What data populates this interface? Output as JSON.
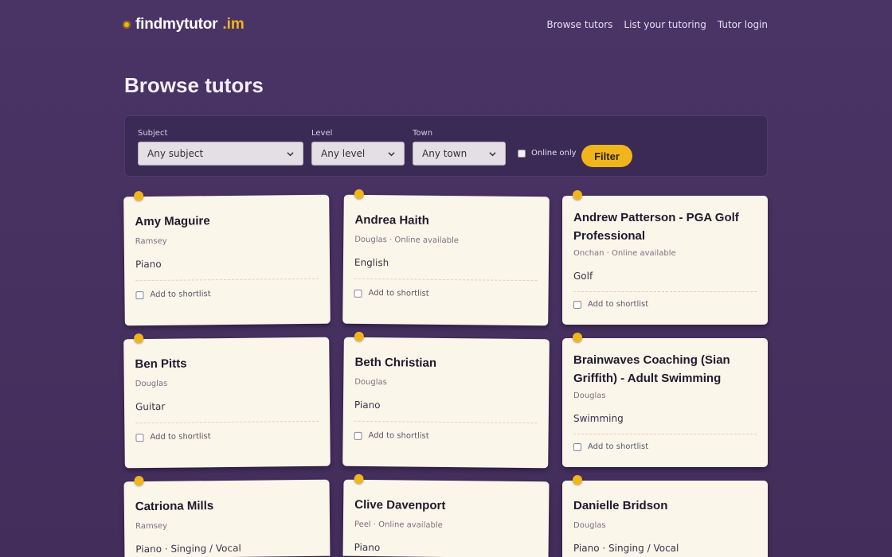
{
  "header": {
    "logo_text": "findmytutor",
    "logo_tld": ".im",
    "nav": [
      "Browse tutors",
      "List your tutoring",
      "Tutor login"
    ]
  },
  "page_title": "Browse tutors",
  "filter": {
    "subject_label": "Subject",
    "subject_value": "Any subject",
    "level_label": "Level",
    "level_value": "Any level",
    "town_label": "Town",
    "town_value": "Any town",
    "online_label": "Online only",
    "button_label": "Filter"
  },
  "shortlist_label": "Add to shortlist",
  "cards": [
    {
      "name": "Amy Maguire",
      "meta": "Ramsey",
      "subject": "Piano"
    },
    {
      "name": "Andrea Haith",
      "meta": "Douglas · Online available",
      "subject": "English"
    },
    {
      "name": "Andrew Patterson - PGA Golf Professional",
      "meta": "Onchan · Online available",
      "subject": "Golf"
    },
    {
      "name": "Ben Pitts",
      "meta": "Douglas",
      "subject": "Guitar"
    },
    {
      "name": "Beth Christian",
      "meta": "Douglas",
      "subject": "Piano"
    },
    {
      "name": "Brainwaves Coaching (Sian Griffith) - Adult Swimming",
      "meta": "Douglas",
      "subject": "Swimming"
    },
    {
      "name": "Catriona Mills",
      "meta": "Ramsey",
      "subject": "Piano · Singing / Vocal"
    },
    {
      "name": "Clive Davenport",
      "meta": "Peel · Online available",
      "subject": "Piano"
    },
    {
      "name": "Danielle Bridson",
      "meta": "Douglas",
      "subject": "Piano · Singing / Vocal"
    }
  ],
  "colors": {
    "accent": "#f0b51b",
    "background": "#46305f",
    "card": "#fbf6ea"
  }
}
